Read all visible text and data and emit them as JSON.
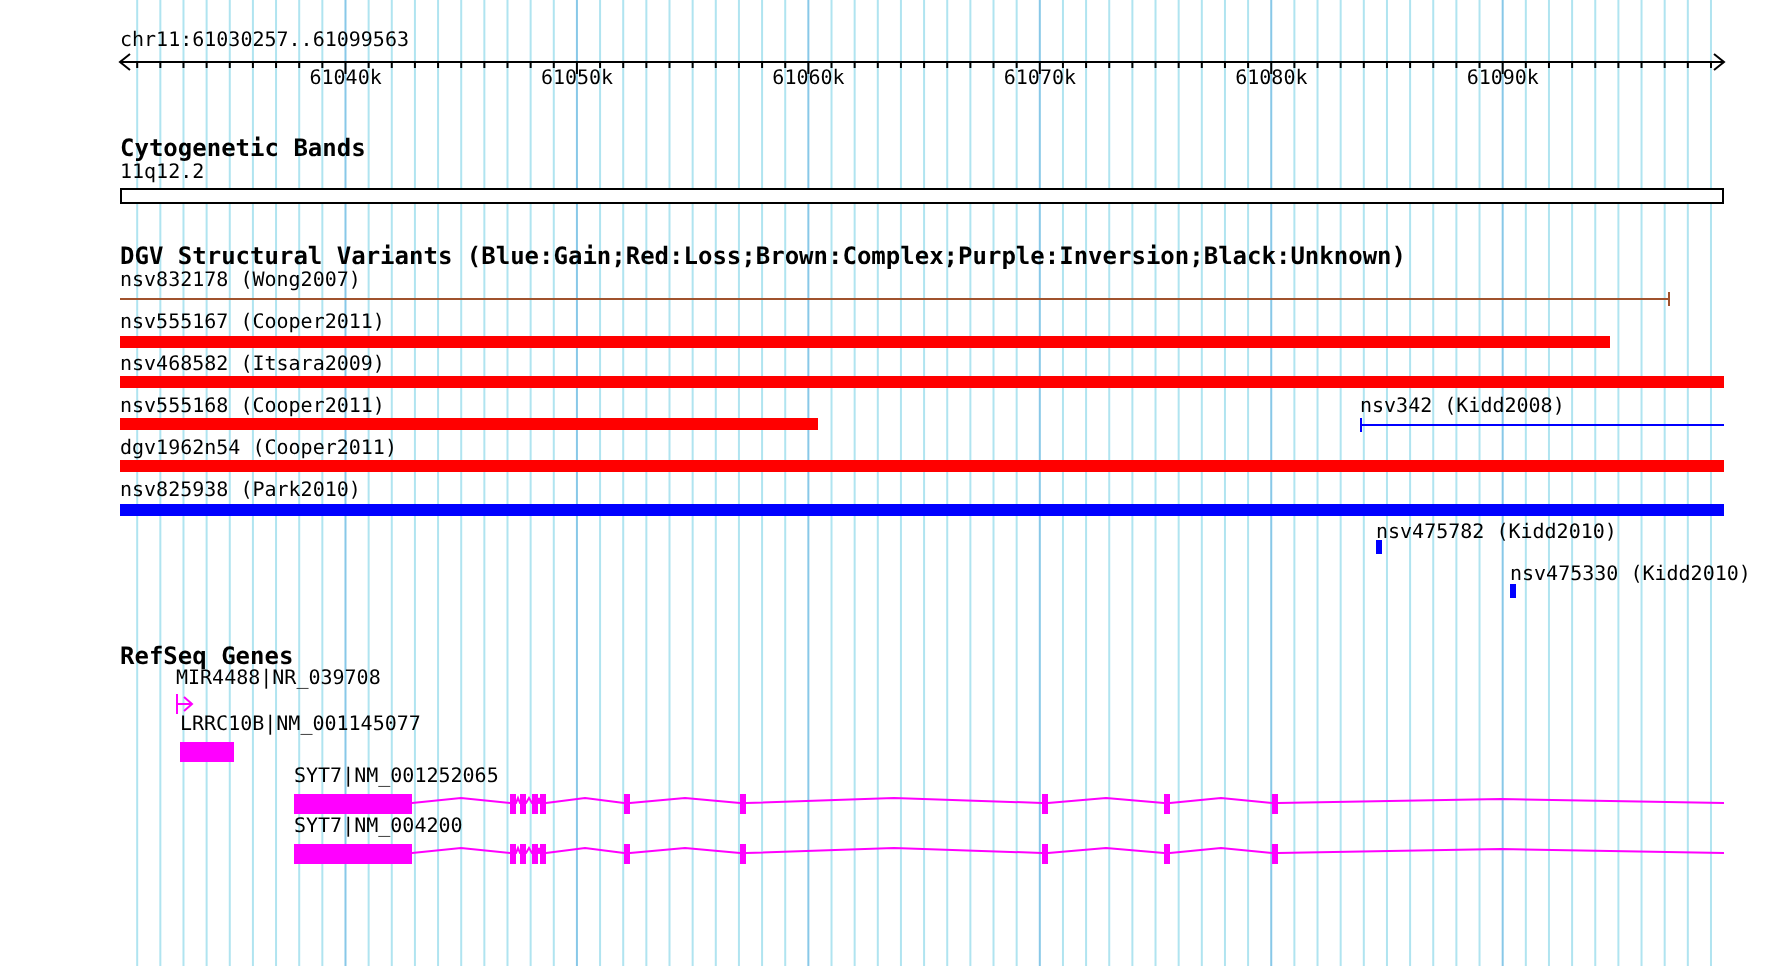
{
  "ruler": {
    "region": "chr11:61030257..61099563",
    "ticks": [
      "61040k",
      "61050k",
      "61060k",
      "61070k",
      "61080k",
      "61090k"
    ]
  },
  "cytogenetic_bands": {
    "title": "Cytogenetic Bands",
    "band": "11q12.2"
  },
  "dgv_variants": {
    "title": "DGV Structural Variants (Blue:Gain;Red:Loss;Brown:Complex;Purple:Inversion;Black:Unknown)",
    "variants": [
      {
        "label": "nsv832178 (Wong2007)",
        "kind": "span",
        "color": "#a0522d"
      },
      {
        "label": "nsv555167 (Cooper2011)",
        "kind": "block",
        "color": "#ff0000"
      },
      {
        "label": "nsv468582 (Itsara2009)",
        "kind": "block",
        "color": "#ff0000"
      },
      {
        "label": "nsv555168 (Cooper2011)",
        "kind": "block",
        "color": "#ff0000"
      },
      {
        "label": "nsv342 (Kidd2008)",
        "kind": "span",
        "color": "#0000ff"
      },
      {
        "label": "dgv1962n54 (Cooper2011)",
        "kind": "block",
        "color": "#ff0000"
      },
      {
        "label": "nsv825938 (Park2010)",
        "kind": "block",
        "color": "#0000ff"
      },
      {
        "label": "nsv475782 (Kidd2010)",
        "kind": "block",
        "color": "#0000ff"
      },
      {
        "label": "nsv475330 (Kidd2010)",
        "kind": "block",
        "color": "#0000ff"
      }
    ]
  },
  "refseq_genes": {
    "title": "RefSeq Genes",
    "genes": [
      {
        "label": "MIR4488|NR_039708",
        "kind": "arrow"
      },
      {
        "label": "LRRC10B|NM_001145077",
        "kind": "block"
      },
      {
        "label": "SYT7|NM_001252065",
        "kind": "gene_model"
      },
      {
        "label": "SYT7|NM_004200",
        "kind": "gene_model"
      }
    ]
  }
}
